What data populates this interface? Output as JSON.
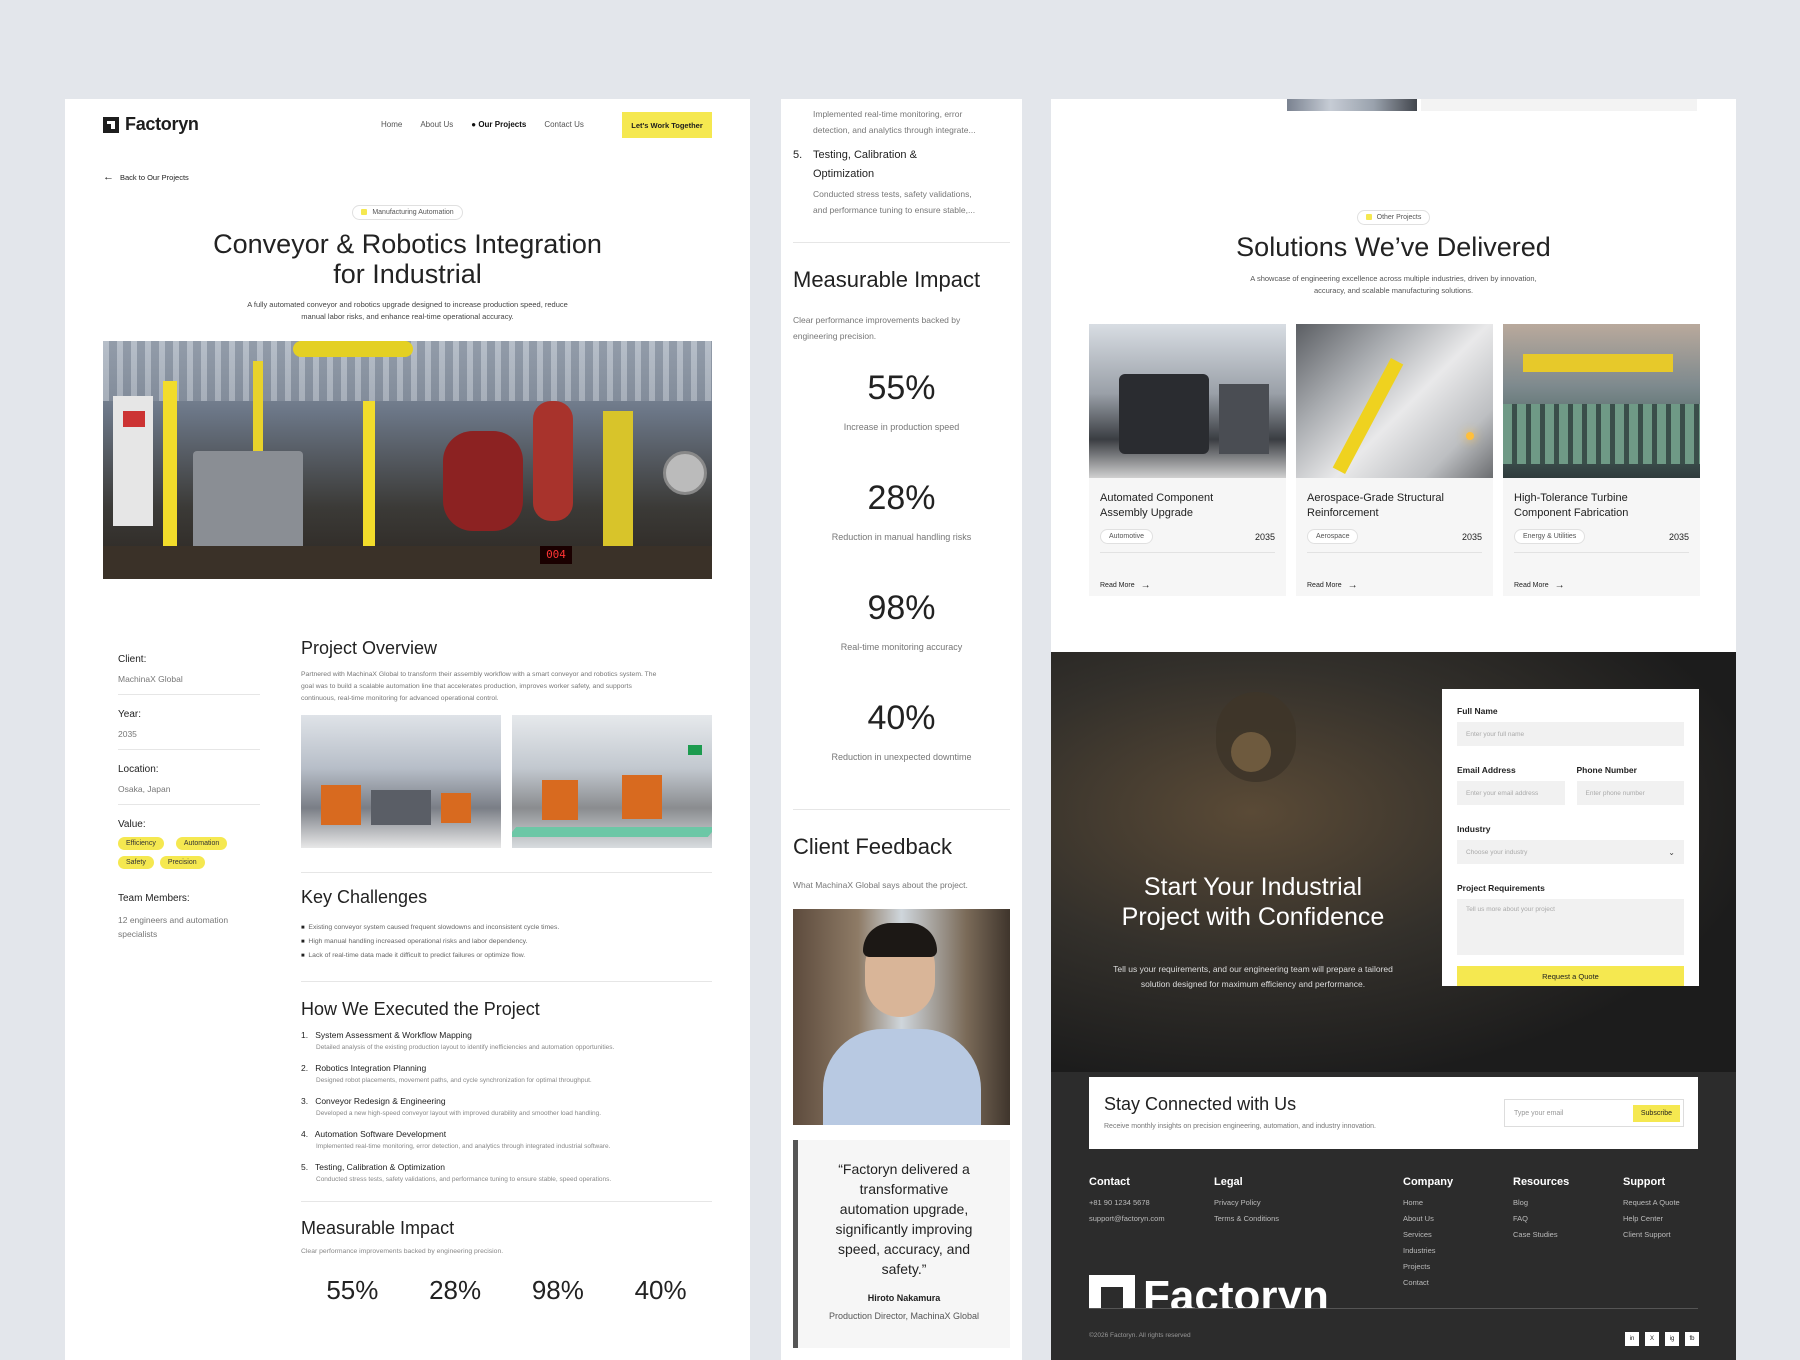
{
  "left": {
    "brand": "Factoryn",
    "nav": [
      "Home",
      "About Us",
      "Our Projects",
      "Contact Us"
    ],
    "cta": "Let's Work Together",
    "back": "Back to Our Projects",
    "tag": "Manufacturing Automation",
    "title_line1": "Conveyor & Robotics Integration",
    "title_line2": "for Industrial",
    "subtitle_line1": "A fully automated conveyor and robotics upgrade designed to increase production speed, reduce",
    "subtitle_line2": "manual labor risks, and enhance real-time operational accuracy.",
    "info": {
      "client_label": "Client:",
      "client": "MachinaX Global",
      "year_label": "Year:",
      "year": "2035",
      "location_label": "Location:",
      "location": "Osaka, Japan",
      "value_label": "Value:",
      "values": [
        "Efficiency",
        "Automation",
        "Safety",
        "Precision"
      ],
      "team_label": "Team Members:",
      "team_line1": "12 engineers and automation",
      "team_line2": "specialists"
    },
    "overview": {
      "heading": "Project Overview",
      "line1": "Partnered with MachinaX Global to transform their assembly workflow with a smart conveyor and robotics system. The",
      "line2": "goal was to build a scalable automation line that accelerates production, improves worker safety, and supports",
      "line3": "continuous, real-time monitoring for advanced operational control."
    },
    "challenges": {
      "heading": "Key Challenges",
      "items": [
        "Existing conveyor system caused frequent slowdowns and inconsistent cycle times.",
        "High manual handling increased operational risks and labor dependency.",
        "Lack of real-time data made it difficult to predict failures or optimize flow."
      ]
    },
    "executed": {
      "heading": "How We Executed the Project",
      "steps": [
        {
          "num": "1.",
          "title": "System Assessment & Workflow Mapping",
          "desc": "Detailed analysis of the existing production layout to identify inefficiencies and automation opportunities."
        },
        {
          "num": "2.",
          "title": "Robotics Integration Planning",
          "desc": "Designed robot placements, movement paths, and cycle synchronization for optimal throughput."
        },
        {
          "num": "3.",
          "title": "Conveyor Redesign & Engineering",
          "desc": "Developed a new high-speed conveyor layout with improved durability and smoother load handling."
        },
        {
          "num": "4.",
          "title": "Automation Software Development",
          "desc": "Implemented real-time monitoring, error detection, and analytics through integrated industrial software."
        },
        {
          "num": "5.",
          "title": "Testing, Calibration & Optimization",
          "desc": "Conducted stress tests, safety validations, and performance tuning to ensure stable, speed operations."
        }
      ]
    },
    "impact": {
      "heading": "Measurable Impact",
      "sub": "Clear performance improvements backed by engineering precision.",
      "nums": [
        "55%",
        "28%",
        "98%",
        "40%"
      ]
    }
  },
  "mid": {
    "top_line1": "Implemented real-time monitoring, error",
    "top_line2": "detection, and analytics through integrate...",
    "step5_num": "5.",
    "step5_title_line1": "Testing, Calibration &",
    "step5_title_line2": "Optimization",
    "step5_line1": "Conducted stress tests, safety validations,",
    "step5_line2": "and performance tuning to ensure stable,...",
    "impact_heading": "Measurable Impact",
    "impact_line1": "Clear performance improvements backed by",
    "impact_line2": "engineering precision.",
    "stats": [
      {
        "n": "55%",
        "l": "Increase in production speed"
      },
      {
        "n": "28%",
        "l": "Reduction in manual handling risks"
      },
      {
        "n": "98%",
        "l": "Real-time monitoring accuracy"
      },
      {
        "n": "40%",
        "l": "Reduction in unexpected downtime"
      }
    ],
    "feedback_heading": "Client Feedback",
    "feedback_sub": "What MachinaX Global says about the project.",
    "quote_lines": [
      "“Factoryn delivered a",
      "transformative",
      "automation upgrade,",
      "significantly improving",
      "speed, accuracy, and",
      "safety.”"
    ],
    "person": "Hiroto Nakamura",
    "role": "Production Director, MachinaX Global"
  },
  "right": {
    "tag": "Other Projects",
    "heading": "Solutions We’ve Delivered",
    "sub_line1": "A showcase of engineering excellence across multiple industries, driven by innovation,",
    "sub_line2": "accuracy, and scalable manufacturing solutions.",
    "projects": [
      {
        "t1": "Automated Component",
        "t2": "Assembly Upgrade",
        "tag": "Automotive",
        "year": "2035",
        "link": "Read More"
      },
      {
        "t1": "Aerospace-Grade Structural",
        "t2": "Reinforcement",
        "tag": "Aerospace",
        "year": "2035",
        "link": "Read More"
      },
      {
        "t1": "High-Tolerance Turbine",
        "t2": "Component Fabrication",
        "tag": "Energy & Utilities",
        "year": "2035",
        "link": "Read More"
      }
    ],
    "cta_line1": "Start Your Industrial",
    "cta_line2": "Project with Confidence",
    "cta_sub_line1": "Tell us your requirements, and our engineering team will prepare a tailored",
    "cta_sub_line2": "solution designed for maximum efficiency and performance.",
    "form": {
      "name_label": "Full Name",
      "name_ph": "Enter your full name",
      "email_label": "Email Address",
      "email_ph": "Enter your email address",
      "phone_label": "Phone Number",
      "phone_ph": "Enter phone number",
      "industry_label": "Industry",
      "industry_ph": "Choose your industry",
      "req_label": "Project Requirements",
      "req_ph": "Tell us more about your project",
      "submit": "Request a Quote"
    },
    "newsletter": {
      "heading": "Stay Connected with Us",
      "sub": "Receive monthly insights on precision engineering, automation, and industry innovation.",
      "ph": "Type your email",
      "button": "Subscribe"
    },
    "footer": {
      "contact_h": "Contact",
      "phone": "+81 90 1234 5678",
      "email": "support@factoryn.com",
      "legal_h": "Legal",
      "legal": [
        "Privacy Policy",
        "Terms & Conditions"
      ],
      "company_h": "Company",
      "company": [
        "Home",
        "About Us",
        "Services",
        "Industries",
        "Projects",
        "Contact"
      ],
      "resources_h": "Resources",
      "resources": [
        "Blog",
        "FAQ",
        "Case Studies"
      ],
      "support_h": "Support",
      "support": [
        "Request A Quote",
        "Help Center",
        "Client Support"
      ],
      "big_brand": "Factoryn",
      "copyright": "©2026 Factoryn. All rights reserved",
      "social": [
        "in",
        "X",
        "ig",
        "fb"
      ]
    }
  },
  "colors": {
    "accent": "#f5e850",
    "dark": "#2a2a2a",
    "bg": "#e3e6eb"
  }
}
